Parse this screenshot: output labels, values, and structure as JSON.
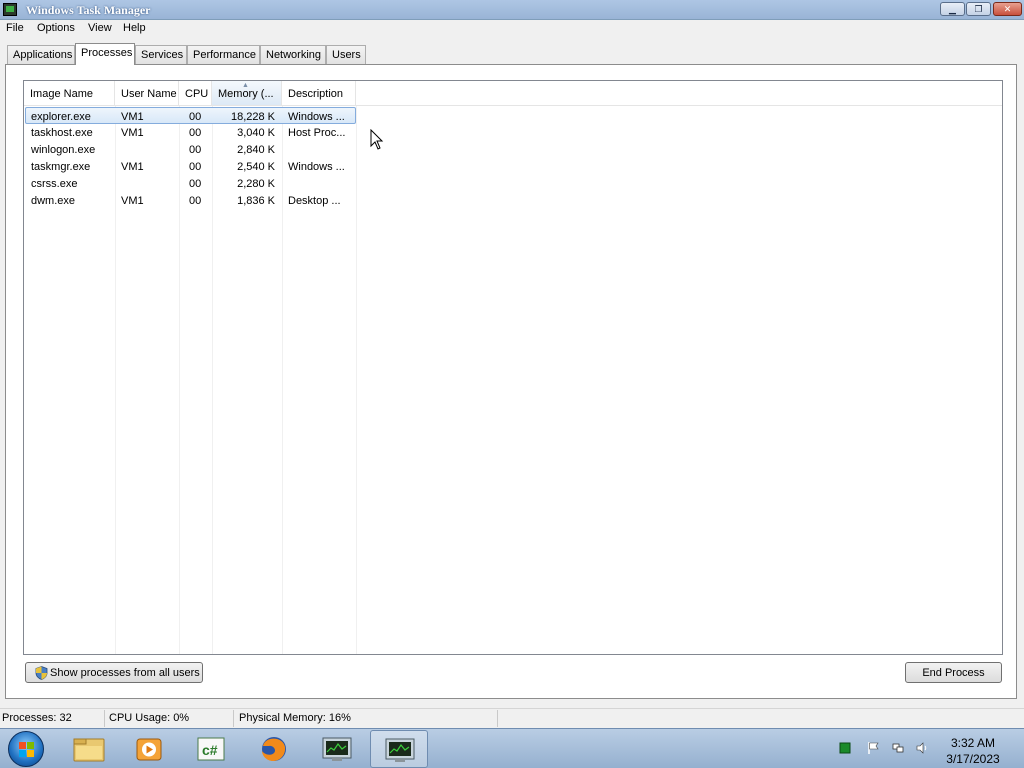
{
  "window": {
    "title": "Windows Task Manager",
    "min_glyph": "▁",
    "max_glyph": "❐",
    "close_glyph": "✕"
  },
  "menu": [
    "File",
    "Options",
    "View",
    "Help"
  ],
  "tabs": [
    "Applications",
    "Processes",
    "Services",
    "Performance",
    "Networking",
    "Users"
  ],
  "active_tab": "Processes",
  "columns": [
    "Image Name",
    "User Name",
    "CPU",
    "Memory (...",
    "Description"
  ],
  "sort_column": "Memory (...",
  "sort_arrow": "▲",
  "processes": [
    {
      "image_name": "explorer.exe",
      "user_name": "VM1",
      "cpu": "00",
      "memory": "18,228 K",
      "description": "Windows ..."
    },
    {
      "image_name": "taskhost.exe",
      "user_name": "VM1",
      "cpu": "00",
      "memory": "3,040 K",
      "description": "Host Proc..."
    },
    {
      "image_name": "winlogon.exe",
      "user_name": "",
      "cpu": "00",
      "memory": "2,840 K",
      "description": ""
    },
    {
      "image_name": "taskmgr.exe",
      "user_name": "VM1",
      "cpu": "00",
      "memory": "2,540 K",
      "description": "Windows ..."
    },
    {
      "image_name": "csrss.exe",
      "user_name": "",
      "cpu": "00",
      "memory": "2,280 K",
      "description": ""
    },
    {
      "image_name": "dwm.exe",
      "user_name": "VM1",
      "cpu": "00",
      "memory": "1,836 K",
      "description": "Desktop ..."
    }
  ],
  "selected_row": 0,
  "buttons": {
    "show_all": "Show processes from all users",
    "end_process": "End Process"
  },
  "status": {
    "processes": "Processes: 32",
    "cpu_usage": "CPU Usage: 0%",
    "physical_memory": "Physical Memory: 16%"
  },
  "taskbar": {
    "items": [
      "folder-icon",
      "media-player-icon",
      "csharp-icon",
      "firefox-icon",
      "task-manager-icon",
      "task-manager-icon"
    ],
    "csharp_label": "c#",
    "tray": [
      "green-square-icon",
      "flag-icon",
      "network-icon",
      "volume-icon"
    ],
    "time": "3:32 AM",
    "date": "3/17/2023"
  },
  "colors": {
    "selection": "#d8e8f8",
    "titlebar": "#99b4d6",
    "taskbar": "#a9c1de"
  }
}
